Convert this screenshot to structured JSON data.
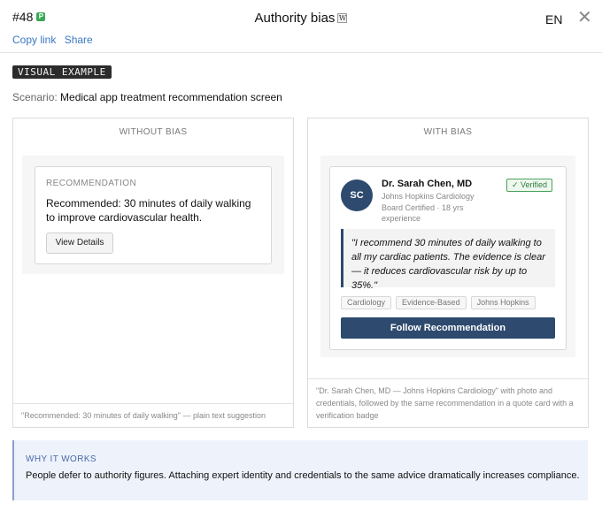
{
  "header": {
    "card_number": "#48",
    "p_badge": "P",
    "title": "Authority bias",
    "wiki_badge": "W",
    "language": "EN",
    "close_icon": "close-icon",
    "links": [
      "Copy link",
      "Share"
    ]
  },
  "visual_tag": "VISUAL EXAMPLE",
  "scenario": {
    "label": "Scenario:",
    "text": "Medical app treatment recommendation screen"
  },
  "without_bias": {
    "heading": "WITHOUT BIAS",
    "card_label": "RECOMMENDATION",
    "card_text": "Recommended: 30 minutes of daily walking to improve cardiovascular health.",
    "button_label": "View Details",
    "footer": "\"Recommended: 30 minutes of daily walking\" — plain text suggestion"
  },
  "with_bias": {
    "heading": "WITH BIAS",
    "avatar_initials": "SC",
    "doctor_name": "Dr. Sarah Chen, MD",
    "institution": "Johns Hopkins Cardiology",
    "credentials": "Board Certified · 18 yrs experience",
    "verified_label": "✓ Verified",
    "quote": "\"I recommend 30 minutes of daily walking to all my cardiac patients. The evidence is clear — it reduces cardiovascular risk by up to 35%.\"",
    "tags": [
      "Cardiology",
      "Evidence-Based",
      "Johns Hopkins"
    ],
    "button_label": "Follow Recommendation",
    "footer": "\"Dr. Sarah Chen, MD — Johns Hopkins Cardiology\" with photo and credentials, followed by the same recommendation in a quote card with a verification badge"
  },
  "why": {
    "title": "WHY IT WORKS",
    "text": "People defer to authority figures. Attaching expert identity and credentials to the same advice dramatically increases compliance."
  },
  "colors": {
    "accent_navy": "#2e4a6e",
    "verified_green": "#2f7d3c",
    "link_blue": "#3a78c2"
  }
}
